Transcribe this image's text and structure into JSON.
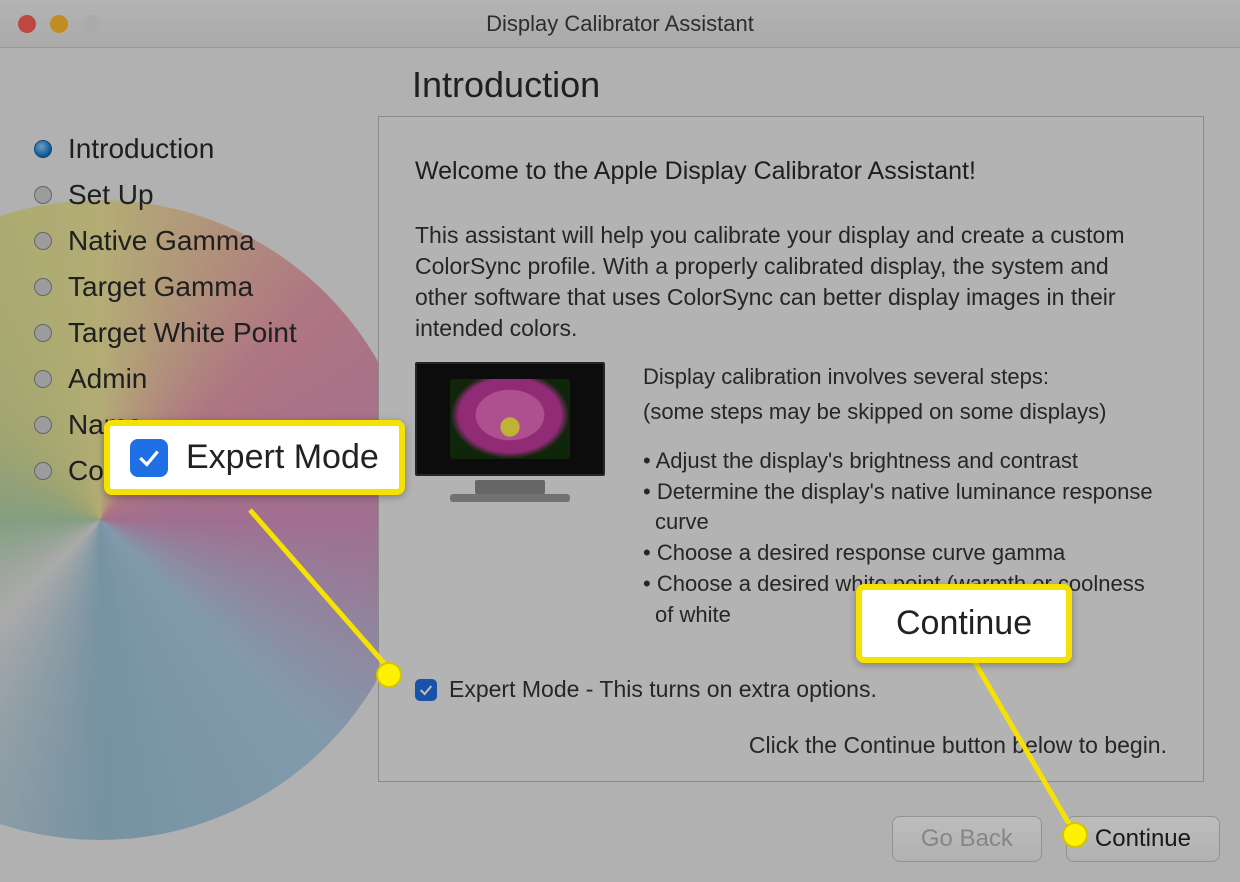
{
  "window": {
    "title": "Display Calibrator Assistant"
  },
  "sidebar": {
    "items": [
      {
        "label": "Introduction",
        "active": true
      },
      {
        "label": "Set Up",
        "active": false
      },
      {
        "label": "Native Gamma",
        "active": false
      },
      {
        "label": "Target Gamma",
        "active": false
      },
      {
        "label": "Target White Point",
        "active": false
      },
      {
        "label": "Admin",
        "active": false
      },
      {
        "label": "Name",
        "active": false
      },
      {
        "label": "Conclusion",
        "active": false
      }
    ]
  },
  "page": {
    "heading": "Introduction",
    "welcome": "Welcome to the Apple Display Calibrator Assistant!",
    "description": "This assistant will help you calibrate your display and create a custom ColorSync profile.  With a properly calibrated display, the system and other software that uses ColorSync can better display images in their intended colors.",
    "steps_heading": "Display calibration involves several steps:",
    "steps_note": "(some steps may be skipped on some displays)",
    "steps": [
      "Adjust the display's brightness and contrast",
      "Determine the display's native luminance response curve",
      "Choose a desired response curve gamma",
      "Choose a desired white point (warmth or coolness of white"
    ],
    "expert_checkbox_label": "Expert Mode - This turns on extra options.",
    "begin_hint": "Click the Continue button below to begin."
  },
  "buttons": {
    "back": "Go Back",
    "continue": "Continue"
  },
  "callouts": {
    "expert": "Expert Mode",
    "continue": "Continue"
  }
}
